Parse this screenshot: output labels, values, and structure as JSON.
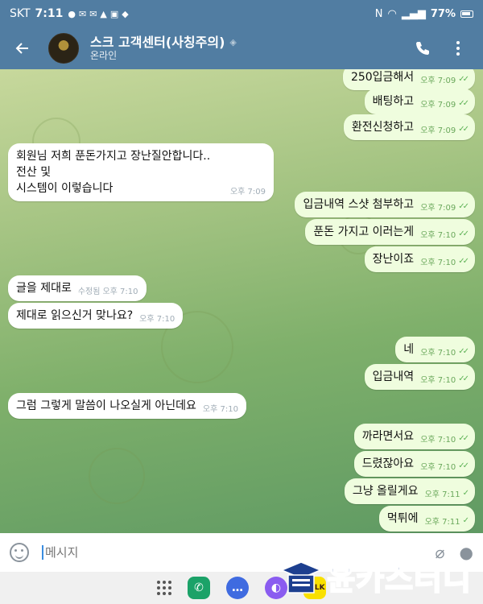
{
  "status_bar": {
    "carrier": "SKT",
    "time": "7:11",
    "battery": "77%"
  },
  "header": {
    "title": "스크 고객센터(사칭주의)",
    "status": "온라인"
  },
  "messages": [
    {
      "dir": "out",
      "text": "250입금해서",
      "time": "오후 7:09"
    },
    {
      "dir": "out",
      "text": "배팅하고",
      "time": "오후 7:09"
    },
    {
      "dir": "out",
      "text": "환전신청하고",
      "time": "오후 7:09"
    },
    {
      "dir": "in",
      "text": "회원님 저희 푼돈가지고 장난질안합니다.. 전산 및\n시스템이 이렇습니다",
      "time": "오후 7:09"
    },
    {
      "dir": "out",
      "text": "입금내역 스샷 첨부하고",
      "time": "오후 7:09"
    },
    {
      "dir": "out",
      "text": "푼돈 가지고 이러는게",
      "time": "오후 7:10"
    },
    {
      "dir": "out",
      "text": "장난이죠",
      "time": "오후 7:10"
    },
    {
      "dir": "in",
      "text": "글을 제대로",
      "time": "오후 7:10",
      "edited": "수정됨"
    },
    {
      "dir": "in",
      "text": "제대로 읽으신거 맞나요?",
      "time": "오후 7:10"
    },
    {
      "dir": "out",
      "text": "네",
      "time": "오후 7:10"
    },
    {
      "dir": "out",
      "text": "입금내역",
      "time": "오후 7:10"
    },
    {
      "dir": "in",
      "text": "그럼 그렇게 말씀이 나오실게 아닌데요",
      "time": "오후 7:10"
    },
    {
      "dir": "out",
      "text": "까라면서요",
      "time": "오후 7:10"
    },
    {
      "dir": "out",
      "text": "드렸잖아요",
      "time": "오후 7:10"
    },
    {
      "dir": "out",
      "text": "그냥 올릴게요",
      "time": "오후 7:11"
    },
    {
      "dir": "out",
      "text": "먹튀에",
      "time": "오후 7:11"
    }
  ],
  "composer": {
    "placeholder": "메시지"
  },
  "watermark": {
    "text": "윤카스터디"
  },
  "colors": {
    "header": "#517da2",
    "outgoing_bubble": "#effdde",
    "incoming_bubble": "#ffffff",
    "read_check": "#5fb357"
  }
}
